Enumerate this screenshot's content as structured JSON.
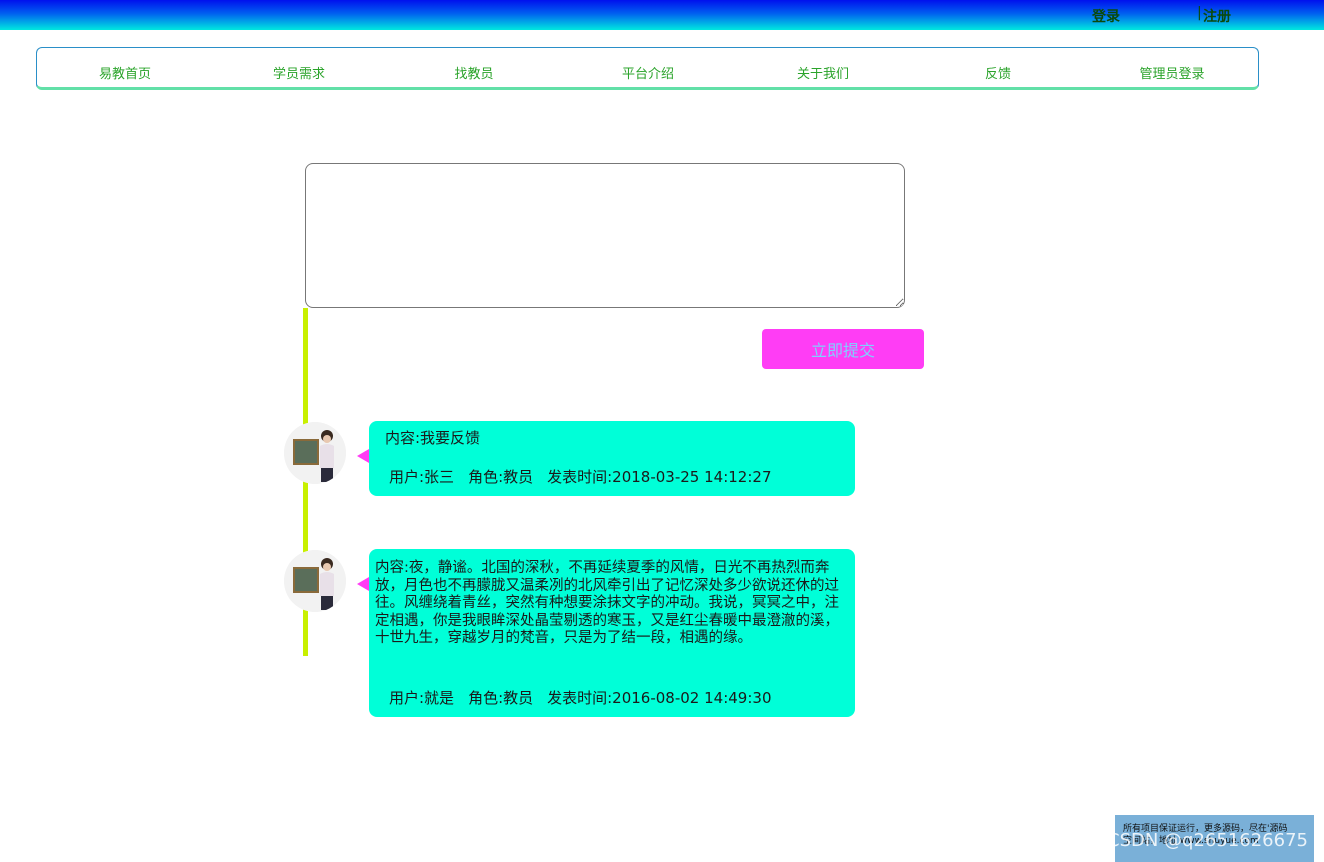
{
  "topbar": {
    "login": "登录",
    "separator": "|",
    "register": "注册"
  },
  "nav": {
    "items": [
      "易教首页",
      "学员需求",
      "找教员",
      "平台介绍",
      "关于我们",
      "反馈",
      "管理员登录"
    ]
  },
  "form": {
    "textarea_value": "",
    "submit_label": "立即提交"
  },
  "feedback": [
    {
      "content": "内容:我要反馈",
      "user": "用户:张三",
      "role": "角色:教员",
      "time": "发表时间:2018-03-25 14:12:27"
    },
    {
      "content": " 内容:夜，静谧。北国的深秋，不再延续夏季的风情，日光不再热烈而奔放，月色也不再朦胧又温柔冽的北风牵引出了记忆深处多少欲说还休的过往。风缠绕着青丝，突然有种想要涂抹文字的冲动。我说，冥冥之中，注定相遇，你是我眼眸深处晶莹剔透的寒玉，又是红尘春暖中最澄澈的溪，十世九生，穿越岁月的梵音，只是为了结一段，相遇的缘。",
      "user": "用户:就是",
      "role": "角色:教员",
      "time": "发表时间:2016-08-02 14:49:30"
    }
  ],
  "footer": {
    "notice_line1": "所有项目保证运行，更多源码，尽在'源码",
    "notice_line2": "空间站，地址 www.shuyue.com",
    "csdn": "CSDN @q2651626675"
  },
  "colors": {
    "accent_pink": "#ff3df5",
    "bubble": "#00ffd8",
    "timeline": "#c8f000",
    "nav_text": "#2aa32a"
  }
}
